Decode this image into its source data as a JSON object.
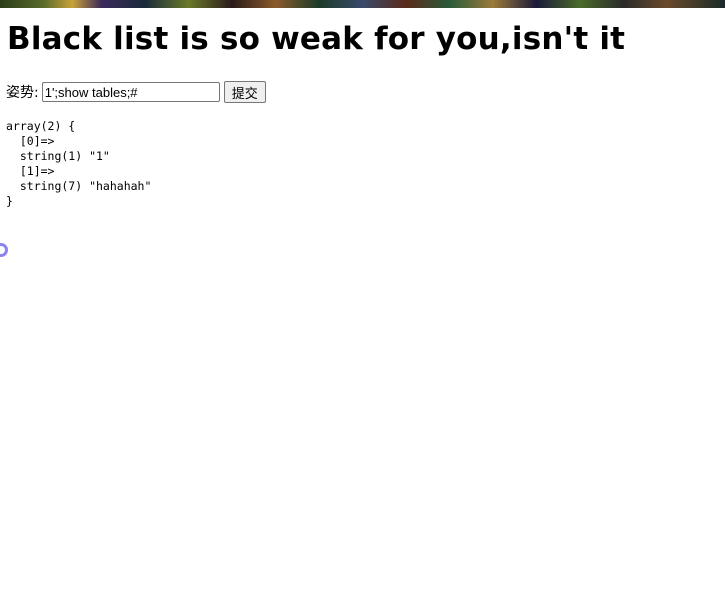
{
  "page": {
    "heading": "Black list is so weak for you,isn't it"
  },
  "form": {
    "label": "姿势:",
    "input_value": "1';show tables;#",
    "submit_label": "提交"
  },
  "result": {
    "dump_text": "array(2) {\n  [0]=>\n  string(1) \"1\"\n  [1]=>\n  string(7) \"hahahah\"\n}"
  }
}
